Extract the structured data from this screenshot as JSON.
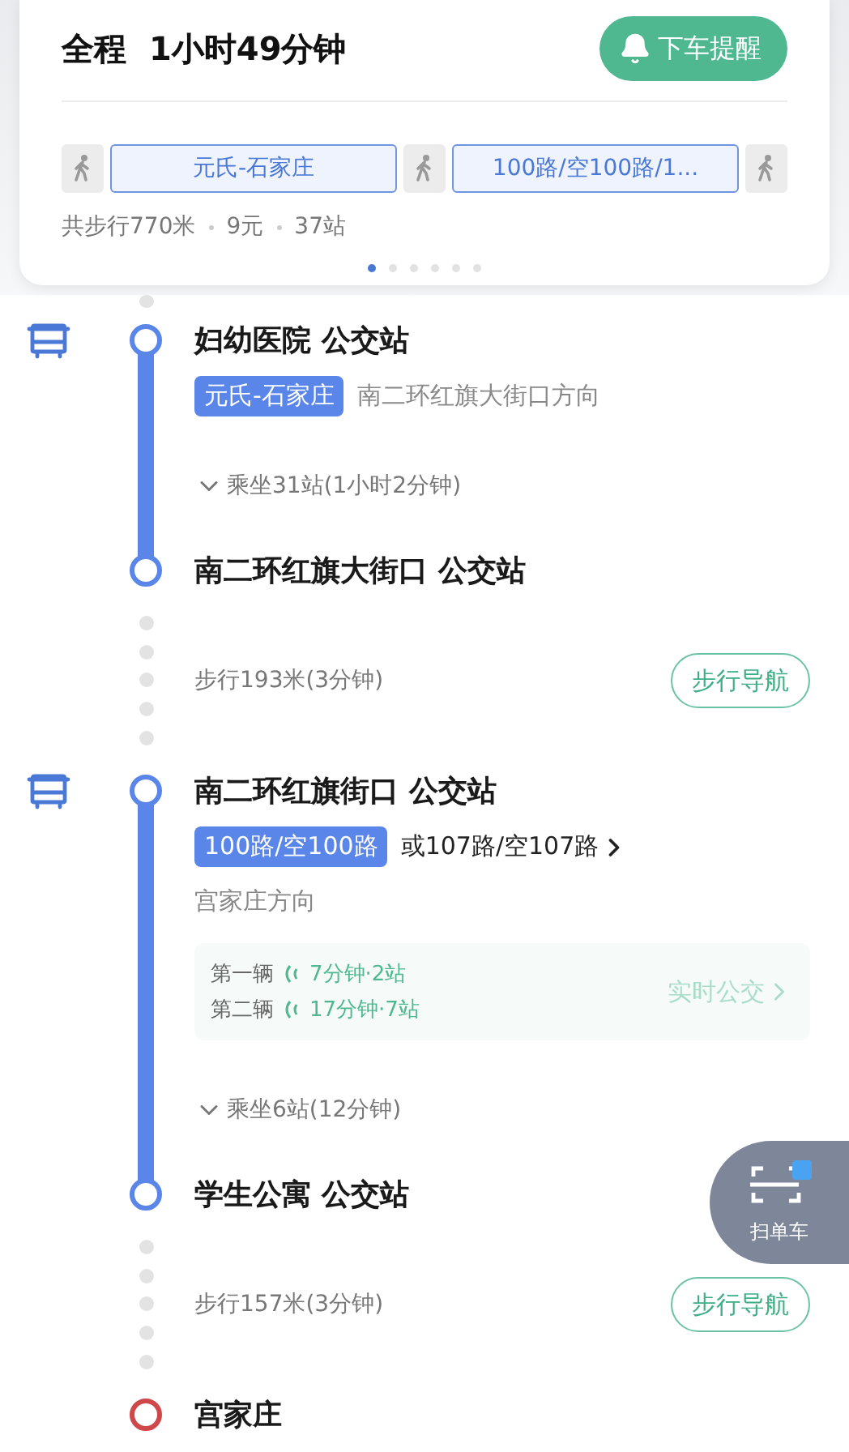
{
  "summary": {
    "label": "全程",
    "duration": "1小时49分钟",
    "alert_button": "下车提醒",
    "chips": [
      {
        "kind": "walk"
      },
      {
        "kind": "line",
        "label": "元氏-石家庄"
      },
      {
        "kind": "walk"
      },
      {
        "kind": "line",
        "label": "100路/空100路/1..."
      },
      {
        "kind": "walk"
      }
    ],
    "stats": [
      "共步行770米",
      "9元",
      "37站"
    ],
    "pages": [
      {
        "selected": true
      },
      {
        "selected": false
      },
      {
        "selected": false
      },
      {
        "selected": false
      },
      {
        "selected": false
      },
      {
        "selected": false
      }
    ]
  },
  "steps": [
    {
      "kind": "board",
      "name": "妇幼医院 公交站"
    },
    {
      "kind": "ride",
      "line": "元氏-石家庄",
      "direction": "南二环红旗大街口方向",
      "ride": "乘坐31站(1小时2分钟)"
    },
    {
      "kind": "alight",
      "name": "南二环红旗大街口 公交站"
    },
    {
      "kind": "walk",
      "text": "步行193米(3分钟)",
      "button": "步行导航"
    },
    {
      "kind": "board",
      "name": "南二环红旗街口 公交站"
    },
    {
      "kind": "ride",
      "line": "100路/空100路",
      "alternative": "或107路/空107路",
      "direction": "宫家庄方向",
      "arrivals": [
        {
          "label": "第一辆",
          "info": "7分钟·2站"
        },
        {
          "label": "第二辆",
          "info": "17分钟·7站"
        }
      ],
      "realtime_link": "实时公交",
      "ride": "乘坐6站(12分钟)"
    },
    {
      "kind": "alight",
      "name": "学生公寓 公交站"
    },
    {
      "kind": "walk",
      "text": "步行157米(3分钟)",
      "button": "步行导航"
    },
    {
      "kind": "destination",
      "name": "宫家庄"
    }
  ],
  "scan_button": "扫单车"
}
